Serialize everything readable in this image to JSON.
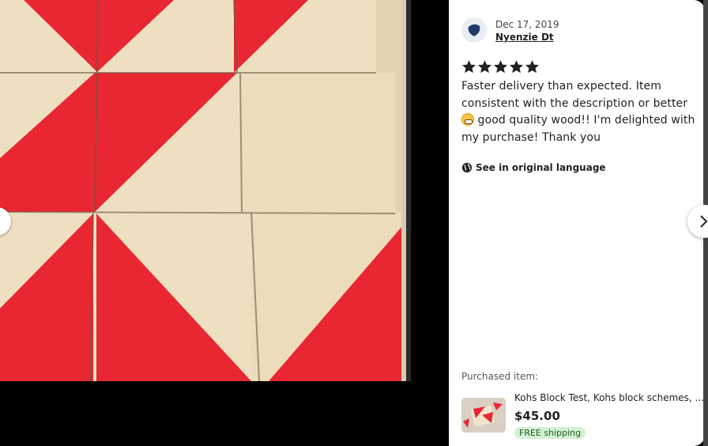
{
  "review": {
    "date": "Dec 17, 2019",
    "reviewer": "Nyenzie Dt",
    "rating": 5,
    "rating_max": 5,
    "text_part1": "Faster delivery than expected. Item consistent with the description or better ",
    "text_part2": " good quality wood!! I'm delighted with my purchase! Thank you",
    "see_original": "See in original language"
  },
  "purchased": {
    "label": "Purchased item:",
    "title": "Kohs Block Test, Kohs block schemes, ...",
    "price": "$45.00",
    "shipping": "FREE shipping"
  },
  "icons": {
    "avatar": "avatar-icon",
    "star": "star-icon",
    "globe": "globe-icon",
    "prev": "chevron-left-icon",
    "next": "chevron-right-icon",
    "emoji": "grinning-face-icon"
  },
  "colors": {
    "block_red": "#e82733",
    "block_wood": "#efdfc1",
    "star": "#222222",
    "shipping_badge": "#d4f0d2"
  }
}
